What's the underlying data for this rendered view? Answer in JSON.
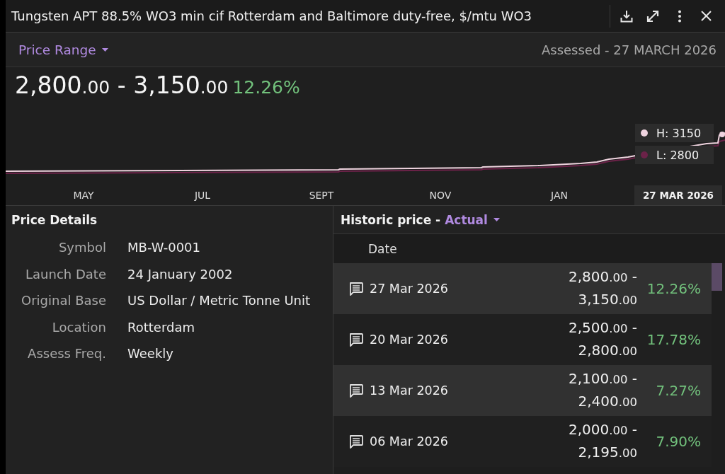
{
  "window": {
    "title": "Tungsten APT 88.5% WO3 min cif Rotterdam and Baltimore duty-free, $/mtu WO3"
  },
  "toolbar": {
    "view_selector": "Price Range",
    "assessed": "Assessed - 27 MARCH 2026"
  },
  "headline": {
    "range": {
      "low": {
        "whole": "2,800",
        "decimals": ".00"
      },
      "dash": "-",
      "high": {
        "whole": "3,150",
        "decimals": ".00"
      }
    },
    "change": "12.26%"
  },
  "chart": {
    "series": [
      {
        "label": "H: 3150",
        "color": "#efd4df"
      },
      {
        "label": "L: 2800",
        "color": "#6b2248"
      }
    ],
    "x_labels": [
      "MAY",
      "JUL",
      "SEPT",
      "NOV",
      "JAN"
    ],
    "current_date": "27 MAR 2026"
  },
  "price_details": {
    "title": "Price Details",
    "fields": [
      {
        "label": "Symbol",
        "value": "MB-W-0001"
      },
      {
        "label": "Launch Date",
        "value": "24 January 2002"
      },
      {
        "label": "Original Base",
        "value": "US Dollar / Metric Tonne Unit"
      },
      {
        "label": "Location",
        "value": "Rotterdam"
      },
      {
        "label": "Assess Freq.",
        "value": "Weekly"
      }
    ]
  },
  "historic_price": {
    "title": "Historic price -",
    "mode": "Actual",
    "columns": [
      "Date"
    ],
    "rows": [
      {
        "date": "27 Mar 2026",
        "range": {
          "low": {
            "whole": "2,800",
            "decimals": ".00"
          },
          "dash": "-",
          "high": {
            "whole": "3,150",
            "decimals": ".00"
          }
        },
        "change": "12.26%"
      },
      {
        "date": "20 Mar 2026",
        "range": {
          "low": {
            "whole": "2,500",
            "decimals": ".00"
          },
          "dash": "-",
          "high": {
            "whole": "2,800",
            "decimals": ".00"
          }
        },
        "change": "17.78%"
      },
      {
        "date": "13 Mar 2026",
        "range": {
          "low": {
            "whole": "2,100",
            "decimals": ".00"
          },
          "dash": "-",
          "high": {
            "whole": "2,400",
            "decimals": ".00"
          }
        },
        "change": "7.27%"
      },
      {
        "date": "06 Mar 2026",
        "range": {
          "low": {
            "whole": "2,000",
            "decimals": ".00"
          },
          "dash": "-",
          "high": {
            "whole": "2,195",
            "decimals": ".00"
          }
        },
        "change": "7.90%"
      }
    ]
  }
}
